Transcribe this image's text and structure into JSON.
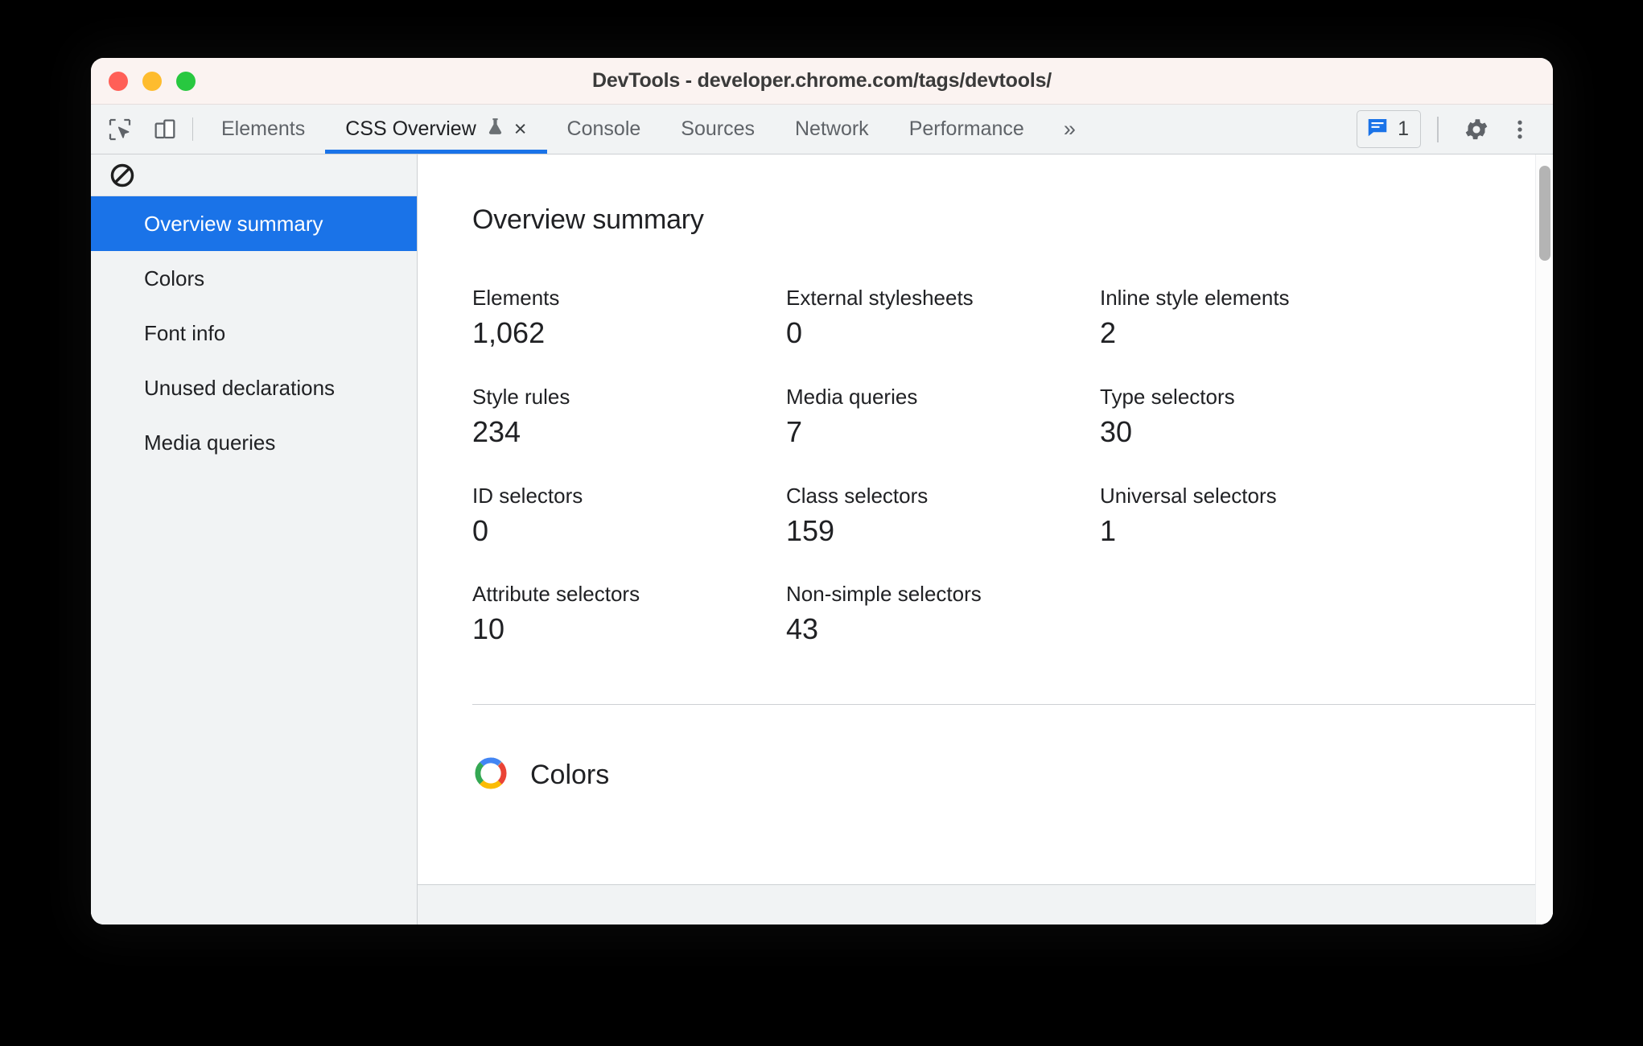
{
  "window": {
    "title": "DevTools - developer.chrome.com/tags/devtools/",
    "traffic_lights": {
      "close": "close-window",
      "minimize": "minimize-window",
      "maximize": "maximize-window"
    },
    "colors": {
      "titlebar_bg": "#fbf3f1",
      "close": "#ff5f57",
      "minimize": "#febc2e",
      "maximize": "#28c840"
    }
  },
  "toolbar": {
    "inspect_icon": "inspect-cursor-icon",
    "device_icon": "device-toolbar-icon",
    "overflow_label": "»",
    "tabs": [
      {
        "label": "Elements",
        "active": false
      },
      {
        "label": "CSS Overview",
        "active": true,
        "experiment_icon": "flask-icon",
        "close_label": "×"
      },
      {
        "label": "Console",
        "active": false
      },
      {
        "label": "Sources",
        "active": false
      },
      {
        "label": "Network",
        "active": false
      },
      {
        "label": "Performance",
        "active": false
      }
    ],
    "issues_badge": {
      "icon": "message-bubble-icon",
      "count": "1"
    },
    "settings_icon": "gear-icon",
    "more_icon": "more-vertical-icon",
    "accent_color": "#1a73e8"
  },
  "sidebar": {
    "clear_icon": "clear-no-entry-icon",
    "items": [
      {
        "label": "Overview summary",
        "selected": true
      },
      {
        "label": "Colors",
        "selected": false
      },
      {
        "label": "Font info",
        "selected": false
      },
      {
        "label": "Unused declarations",
        "selected": false
      },
      {
        "label": "Media queries",
        "selected": false
      }
    ],
    "selected_bg": "#1a73e8"
  },
  "main": {
    "summary_title": "Overview summary",
    "stats": [
      {
        "label": "Elements",
        "value": "1,062"
      },
      {
        "label": "External stylesheets",
        "value": "0"
      },
      {
        "label": "Inline style elements",
        "value": "2"
      },
      {
        "label": "Style rules",
        "value": "234"
      },
      {
        "label": "Media queries",
        "value": "7"
      },
      {
        "label": "Type selectors",
        "value": "30"
      },
      {
        "label": "ID selectors",
        "value": "0"
      },
      {
        "label": "Class selectors",
        "value": "159"
      },
      {
        "label": "Universal selectors",
        "value": "1"
      },
      {
        "label": "Attribute selectors",
        "value": "10"
      },
      {
        "label": "Non-simple selectors",
        "value": "43"
      }
    ],
    "colors_section": {
      "icon": "color-wheel-icon",
      "title": "Colors",
      "wheel_colors": [
        "#ea4335",
        "#fbbc04",
        "#34a853",
        "#4285f4",
        "#9aa0a6"
      ]
    }
  }
}
